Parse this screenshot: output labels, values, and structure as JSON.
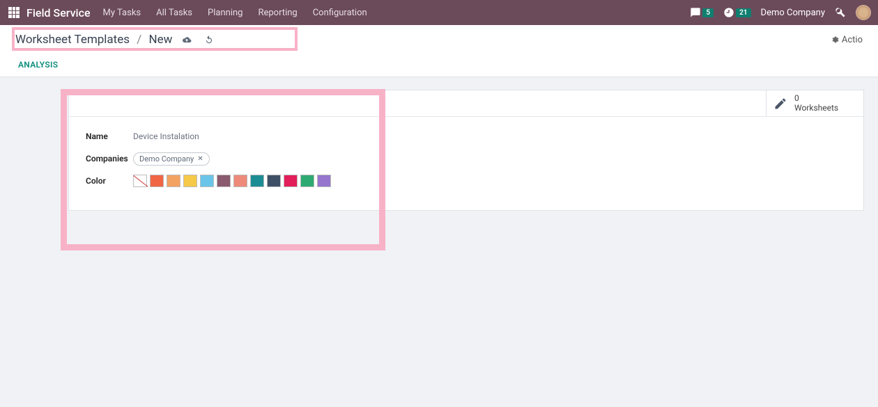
{
  "app": {
    "name": "Field Service"
  },
  "nav": {
    "items": [
      {
        "label": "My Tasks"
      },
      {
        "label": "All Tasks"
      },
      {
        "label": "Planning"
      },
      {
        "label": "Reporting"
      },
      {
        "label": "Configuration"
      }
    ]
  },
  "topbar": {
    "messages_count": "5",
    "activities_count": "21",
    "company": "Demo Company"
  },
  "breadcrumb": {
    "parent": "Worksheet Templates",
    "current": "New",
    "action": "Actio"
  },
  "tabs": [
    {
      "label": "ANALYSIS"
    }
  ],
  "card": {
    "worksheets": {
      "count": "0",
      "label": "Worksheets"
    },
    "fields": {
      "name_label": "Name",
      "name_value": "Device Instalation",
      "companies_label": "Companies",
      "company_tag": "Demo Company",
      "color_label": "Color"
    },
    "swatches": [
      {
        "type": "none",
        "color": "#ffffff"
      },
      {
        "type": "solid",
        "color": "#f06544"
      },
      {
        "type": "solid",
        "color": "#f4a261"
      },
      {
        "type": "solid",
        "color": "#f6c949"
      },
      {
        "type": "solid",
        "color": "#6bc5e8"
      },
      {
        "type": "solid",
        "color": "#8a5a6e"
      },
      {
        "type": "solid",
        "color": "#ed8a7a"
      },
      {
        "type": "solid",
        "color": "#1d8d95"
      },
      {
        "type": "solid",
        "color": "#3e5065"
      },
      {
        "type": "solid",
        "color": "#e21e5b"
      },
      {
        "type": "solid",
        "color": "#2daa72"
      },
      {
        "type": "solid",
        "color": "#9575cd"
      }
    ]
  }
}
